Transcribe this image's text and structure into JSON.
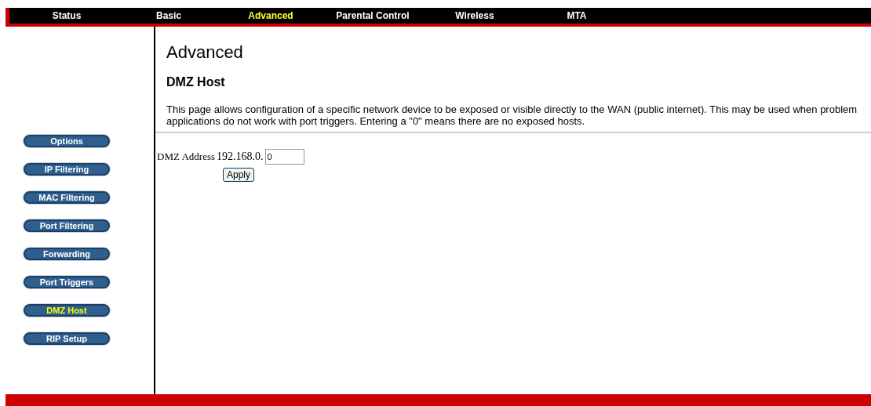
{
  "nav": [
    {
      "label": "Status",
      "selected": false
    },
    {
      "label": "Basic",
      "selected": false
    },
    {
      "label": "Advanced",
      "selected": true
    },
    {
      "label": "Parental Control",
      "selected": false
    },
    {
      "label": "Wireless",
      "selected": false
    },
    {
      "label": "MTA",
      "selected": false
    }
  ],
  "sidebar": {
    "items": [
      {
        "label": "Options",
        "selected": false
      },
      {
        "label": "IP Filtering",
        "selected": false
      },
      {
        "label": "MAC Filtering",
        "selected": false
      },
      {
        "label": "Port Filtering",
        "selected": false
      },
      {
        "label": "Forwarding",
        "selected": false
      },
      {
        "label": "Port Triggers",
        "selected": false
      },
      {
        "label": "DMZ Host",
        "selected": true
      },
      {
        "label": "RIP Setup",
        "selected": false
      }
    ]
  },
  "page": {
    "title": "Advanced",
    "subtitle": "DMZ Host",
    "description": "This page allows configuration of a specific network device to be exposed or visible directly to the WAN (public internet).  This may be used when problem applications do not work with port triggers. Entering a \"0\" means there are no exposed hosts."
  },
  "form": {
    "label": "DMZ Address",
    "prefix": "192.168.0.",
    "value": "0",
    "button": "Apply"
  }
}
